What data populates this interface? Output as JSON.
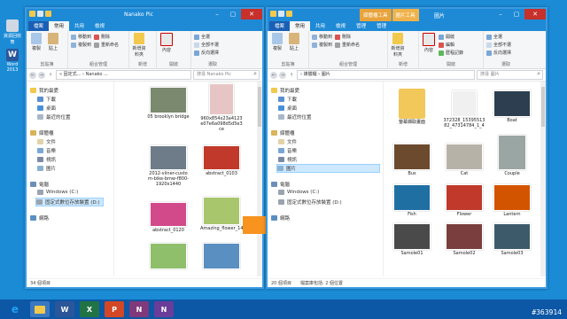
{
  "desktop": {
    "icons": [
      {
        "label": "資源回收筒",
        "icon": "recycle-bin-icon",
        "color": "#cfd8e3"
      },
      {
        "label": "Word 2013",
        "icon": "word-icon",
        "color": "#2b579a"
      }
    ]
  },
  "left_window": {
    "title": "Nanako Pic",
    "tabs": [
      "檔案",
      "常用",
      "共用",
      "檢視"
    ],
    "ribbon": {
      "clipboard": {
        "copy": "複製",
        "paste": "貼上",
        "label": "剪貼簿"
      },
      "organize": {
        "move_to": "移動到",
        "copy_to": "複製到",
        "delete": "刪除",
        "rename": "重新命名",
        "label": "組合管理"
      },
      "new": {
        "new_folder": "新增資料夾",
        "label": "新增"
      },
      "open": {
        "properties": "內容",
        "label": "開啟"
      },
      "select": {
        "select_all": "全選",
        "select_none": "全部不選",
        "invert": "反向選擇",
        "label": "選取"
      }
    },
    "address": "« 固定式... › Nanako ...",
    "search_placeholder": "搜尋 Nanako Pic",
    "nav": {
      "favorites": "我的最愛",
      "downloads": "下載",
      "desktop": "桌面",
      "recent": "最近的位置",
      "libraries": "媒體櫃",
      "documents": "文件",
      "music": "音樂",
      "videos": "視訊",
      "pictures": "圖片",
      "computer": "電腦",
      "drive_c": "Windows (C:)",
      "drive_d": "固定式數位存放裝置 (D:)",
      "network": "網路"
    },
    "thumbnails": [
      {
        "label": "05 brooklyn bridge",
        "color": "#7b8a6e"
      },
      {
        "label": "960x854x23a4123e07e6a098d5d5e3ce",
        "color": "#e8c5c5"
      },
      {
        "label": "2012-viiner-custom-bike-bmw-f800-1920x1440",
        "color": "#6e7b88"
      },
      {
        "label": "abstract_0103",
        "color": "#c0392b"
      },
      {
        "label": "abstract_0120",
        "color": "#d24a8a"
      },
      {
        "label": "Amazing_flower_14",
        "color": "#a8c66c"
      },
      {
        "label": "",
        "color": "#8fbf6a"
      },
      {
        "label": "",
        "color": "#5a8fc2"
      }
    ],
    "status": "34 個項目"
  },
  "right_window": {
    "title": "圖片",
    "context_tabs": [
      "媒體櫃工具",
      "圖片工具"
    ],
    "tabs": [
      "檔案",
      "常用",
      "共用",
      "檢視",
      "管理",
      "管理"
    ],
    "ribbon": {
      "clipboard": {
        "copy": "複製",
        "paste": "貼上",
        "label": "剪貼簿"
      },
      "organize": {
        "move_to": "移動到",
        "copy_to": "複製到",
        "delete": "刪除",
        "rename": "重新命名",
        "label": "組合管理"
      },
      "new": {
        "new_folder": "新增資料夾",
        "label": "新增"
      },
      "open": {
        "properties": "內容",
        "open": "開啟",
        "edit": "編輯",
        "history": "歷程記錄",
        "label": "開啟"
      },
      "select": {
        "select_all": "全選",
        "select_none": "全部不選",
        "invert": "反向選擇",
        "label": "選取"
      }
    },
    "address": "› 媒體櫃 › 圖片",
    "search_placeholder": "搜尋 圖片",
    "nav": {
      "favorites": "我的最愛",
      "downloads": "下載",
      "desktop": "桌面",
      "recent": "最近的位置",
      "libraries": "媒體櫃",
      "documents": "文件",
      "music": "音樂",
      "videos": "視訊",
      "pictures": "圖片",
      "computer": "電腦",
      "drive_c": "Windows (C:)",
      "drive_d": "固定式數位存放裝置 (D:)",
      "network": "網路"
    },
    "items": [
      {
        "label": "螢幕擷取畫面",
        "color": "#f3c85a",
        "kind": "folder"
      },
      {
        "label": "372328_1539551382_47314784_1_4",
        "color": "#f0f0f0"
      },
      {
        "label": "Boat",
        "color": "#2c3e50"
      },
      {
        "label": "Bus",
        "color": "#6b4a2e"
      },
      {
        "label": "Cat",
        "color": "#b7b2a8"
      },
      {
        "label": "Couple",
        "color": "#9aa6a3"
      },
      {
        "label": "Fish",
        "color": "#1f6fa3"
      },
      {
        "label": "Flower",
        "color": "#c0392b"
      },
      {
        "label": "Lantern",
        "color": "#d35400"
      },
      {
        "label": "Samole01",
        "color": "#4a4a4a"
      },
      {
        "label": "Samole02",
        "color": "#7a3e3e"
      },
      {
        "label": "Samole03",
        "color": "#3d5a6b"
      }
    ],
    "status": "20 個項目",
    "status2": "檔案庫包括: 2 個位置"
  },
  "taskbar": {
    "items": [
      {
        "name": "ie-icon",
        "glyph": "e",
        "color": "#1ea1f1"
      },
      {
        "name": "explorer-icon",
        "glyph": "",
        "color": "#f2c94c"
      },
      {
        "name": "word-icon",
        "glyph": "W",
        "color": "#2b579a"
      },
      {
        "name": "excel-icon",
        "glyph": "X",
        "color": "#217346"
      },
      {
        "name": "powerpoint-icon",
        "glyph": "P",
        "color": "#d24726"
      },
      {
        "name": "onenote-icon",
        "glyph": "N",
        "color": "#80397b"
      },
      {
        "name": "onenote2-icon",
        "glyph": "N",
        "color": "#6a3d9a"
      }
    ]
  },
  "watermark": "#363914",
  "colors": {
    "accent": "#1e8ad6",
    "arrow": "#f7931e"
  }
}
